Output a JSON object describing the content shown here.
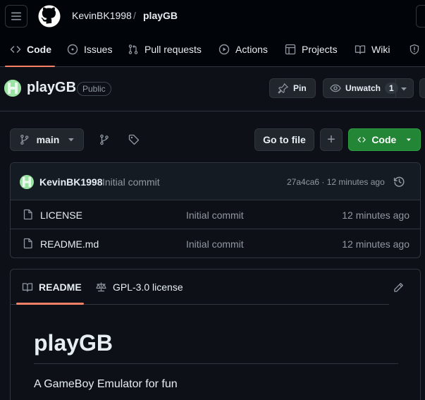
{
  "header": {
    "owner": "KevinBK1998",
    "separator": "/",
    "repo": "playGB"
  },
  "tabs": [
    {
      "label": "Code",
      "icon": "code-icon",
      "active": true
    },
    {
      "label": "Issues",
      "icon": "issue-icon"
    },
    {
      "label": "Pull requests",
      "icon": "pull-request-icon"
    },
    {
      "label": "Actions",
      "icon": "play-icon"
    },
    {
      "label": "Projects",
      "icon": "table-icon"
    },
    {
      "label": "Wiki",
      "icon": "book-icon"
    }
  ],
  "repo": {
    "name": "playGB",
    "visibility": "Public",
    "pin_label": "Pin",
    "watch_label": "Unwatch",
    "watch_count": "1"
  },
  "toolbar": {
    "branch": "main",
    "go_to_file": "Go to file",
    "add": "+",
    "code_label": "Code"
  },
  "latest_commit": {
    "author": "KevinBK1998",
    "message": "Initial commit",
    "hash_time": "27a4ca6 · 12 minutes ago"
  },
  "files": [
    {
      "name": "LICENSE",
      "message": "Initial commit",
      "time": "12 minutes ago"
    },
    {
      "name": "README.md",
      "message": "Initial commit",
      "time": "12 minutes ago"
    }
  ],
  "readme": {
    "tab_readme": "README",
    "tab_license": "GPL-3.0 license",
    "title": "playGB",
    "description": "A GameBoy Emulator for fun"
  },
  "colors": {
    "background": "#0d1117",
    "header_bg": "#010409",
    "border": "#30363d",
    "accent_underline": "#f78166",
    "primary_button": "#238636",
    "muted_text": "#9198a1"
  }
}
